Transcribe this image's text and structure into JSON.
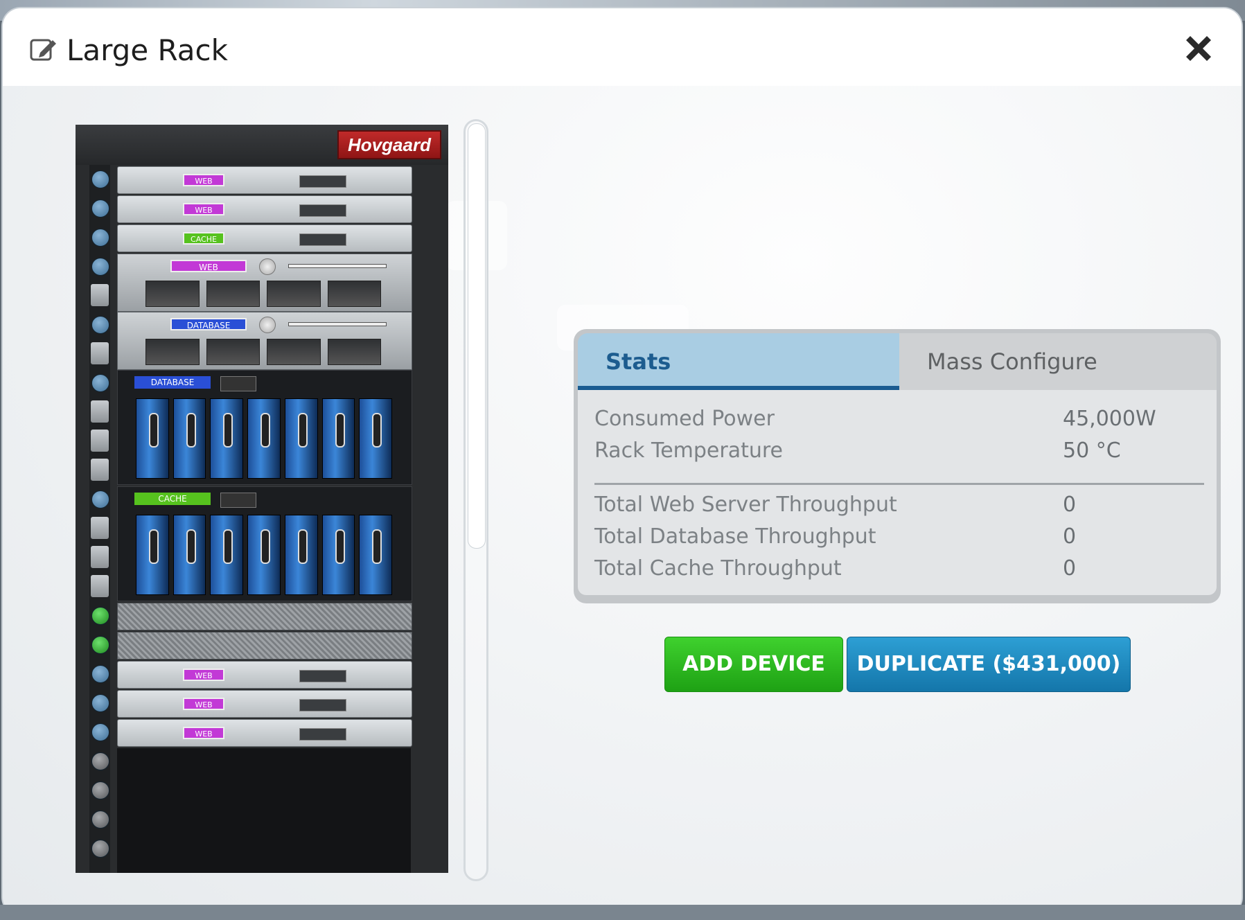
{
  "dialog": {
    "title": "Large Rack",
    "close_icon": "close-icon",
    "edit_icon": "edit-icon"
  },
  "rack": {
    "brand": "Hovgaard",
    "devices": [
      {
        "size": "1U",
        "label": "WEB",
        "color": "#c239d6"
      },
      {
        "size": "1U",
        "label": "WEB",
        "color": "#c239d6"
      },
      {
        "size": "1U",
        "label": "CACHE",
        "color": "#56c21e"
      },
      {
        "size": "2U",
        "label": "WEB",
        "color": "#c239d6"
      },
      {
        "size": "2U",
        "label": "DATABASE",
        "color": "#2a4fd6"
      },
      {
        "size": "4U",
        "label": "DATABASE",
        "color": "#2a4fd6"
      },
      {
        "size": "4U",
        "label": "CACHE",
        "color": "#56c21e"
      },
      {
        "size": "vent"
      },
      {
        "size": "vent"
      },
      {
        "size": "1U",
        "label": "WEB",
        "color": "#c239d6"
      },
      {
        "size": "1U",
        "label": "WEB",
        "color": "#c239d6"
      },
      {
        "size": "1U",
        "label": "WEB",
        "color": "#c239d6"
      }
    ]
  },
  "tabs": {
    "stats": "Stats",
    "mass_configure": "Mass Configure"
  },
  "stats": {
    "consumed_power_label": "Consumed Power",
    "consumed_power_value": "45,000W",
    "rack_temperature_label": "Rack Temperature",
    "rack_temperature_value": "50 °C",
    "web_throughput_label": "Total Web Server Throughput",
    "web_throughput_value": "0",
    "db_throughput_label": "Total Database Throughput",
    "db_throughput_value": "0",
    "cache_throughput_label": "Total Cache Throughput",
    "cache_throughput_value": "0"
  },
  "actions": {
    "add_device": "ADD DEVICE",
    "duplicate": "DUPLICATE ($431,000)"
  },
  "colors": {
    "accent_blue": "#1a5c91",
    "add_green": "#2fbf21",
    "duplicate_blue": "#1f8cc2"
  }
}
